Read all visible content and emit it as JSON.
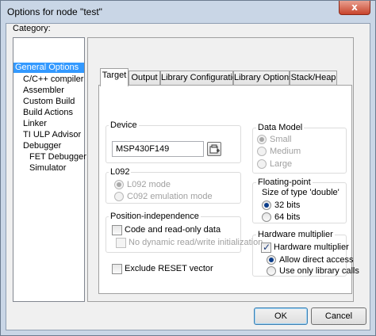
{
  "window": {
    "title": "Options for node \"test\"",
    "close_glyph": "x"
  },
  "category": {
    "label": "Category:",
    "items": [
      {
        "label": "General Options",
        "selected": true
      },
      {
        "label": "C/C++ compiler"
      },
      {
        "label": "Assembler"
      },
      {
        "label": "Custom Build"
      },
      {
        "label": "Build Actions"
      },
      {
        "label": "Linker"
      },
      {
        "label": "TI ULP Advisor"
      },
      {
        "label": "Debugger"
      },
      {
        "label": "FET Debugger"
      },
      {
        "label": "Simulator"
      }
    ]
  },
  "tabs": [
    {
      "label": "Target",
      "active": true
    },
    {
      "label": "Output"
    },
    {
      "label": "Library Configuration"
    },
    {
      "label": "Library Options"
    },
    {
      "label": "Stack/Heap"
    }
  ],
  "target": {
    "device": {
      "title": "Device",
      "value": "MSP430F149",
      "browse_icon": "device-browse-icon"
    },
    "l092": {
      "title": "L092",
      "options": [
        "L092 mode",
        "C092 emulation mode"
      ]
    },
    "position_independence": {
      "title": "Position-independence",
      "code_ro": "Code and read-only data",
      "no_dynamic": "No dynamic read/write initialization"
    },
    "exclude_reset": "Exclude RESET vector",
    "data_model": {
      "title": "Data Model",
      "options": [
        "Small",
        "Medium",
        "Large"
      ]
    },
    "floating_point": {
      "title": "Floating-point",
      "subtitle": "Size of type 'double'",
      "options": [
        "32 bits",
        "64 bits"
      ]
    },
    "hw_multiplier": {
      "title": "Hardware multiplier",
      "checkbox": "Hardware multiplier",
      "options": [
        "Allow direct access",
        "Use only library calls"
      ]
    }
  },
  "buttons": {
    "ok": "OK",
    "cancel": "Cancel"
  }
}
